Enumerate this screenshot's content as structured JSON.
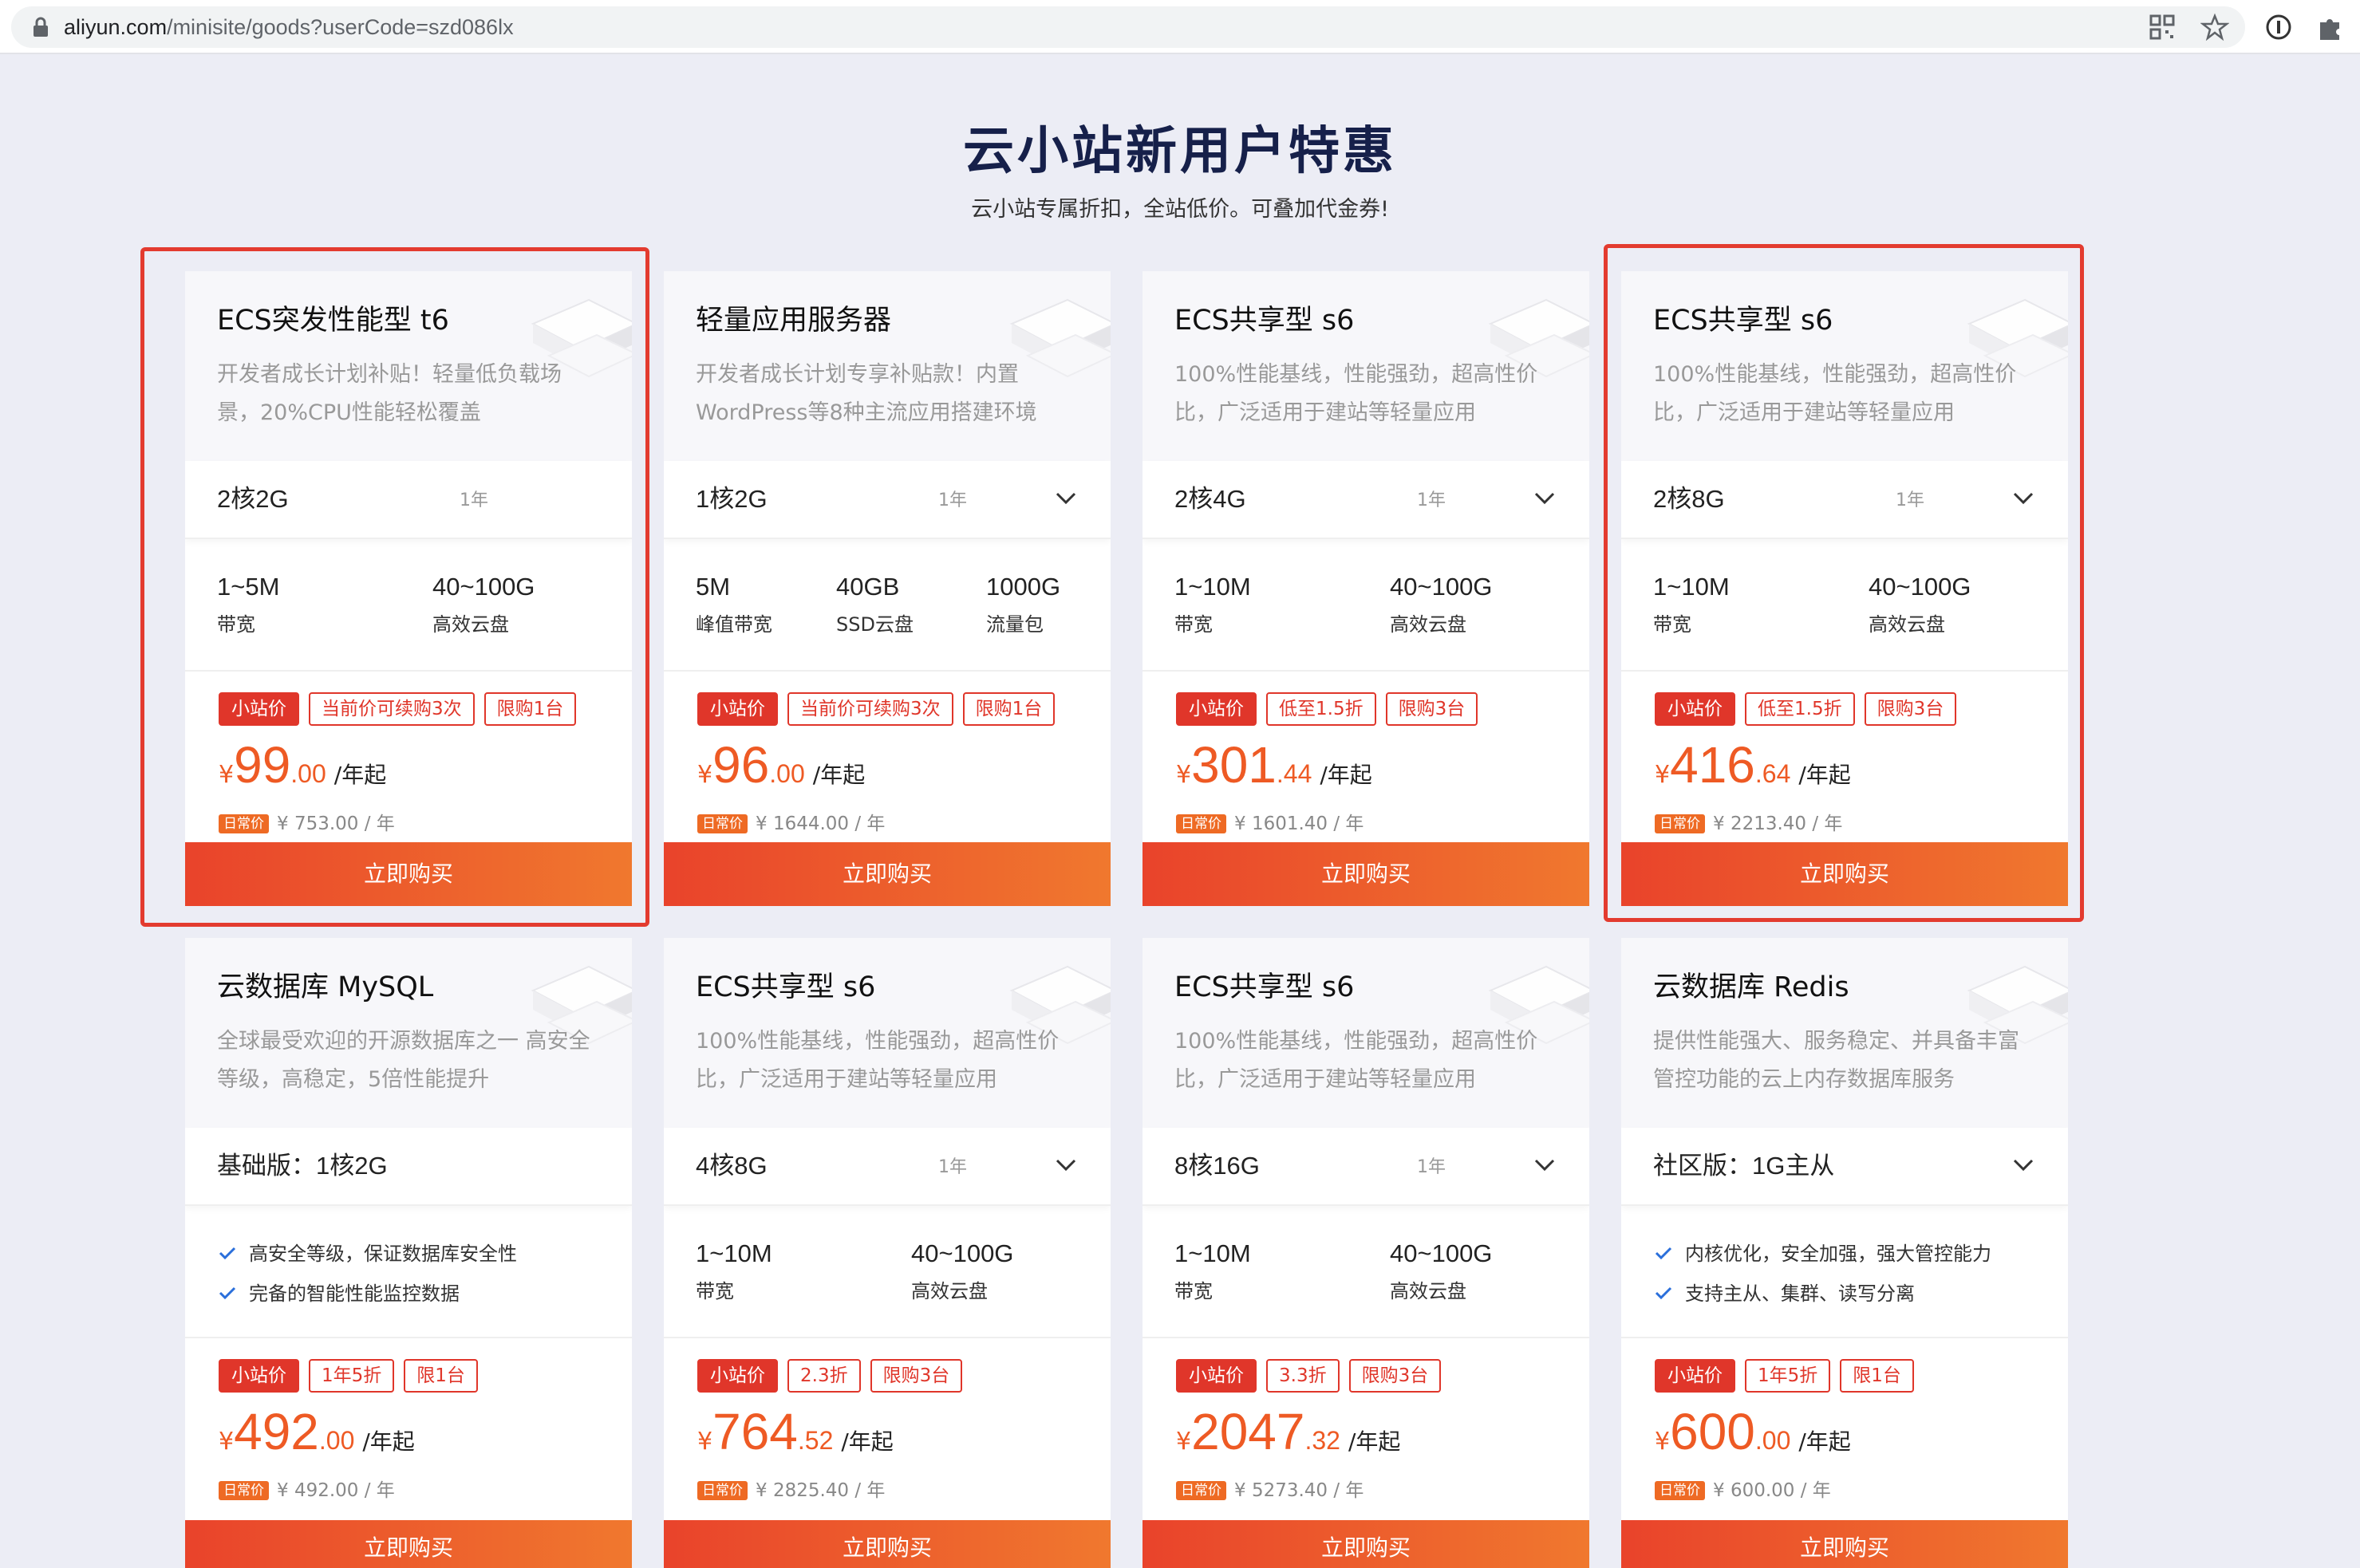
{
  "browser": {
    "url_host": "aliyun.com",
    "url_path": "/minisite/goods?userCode=szd086lx"
  },
  "header": {
    "title": "云小站新用户特惠",
    "subtitle": "云小站专属折扣，全站低价。可叠加代金券!"
  },
  "cards": [
    {
      "title": "ECS突发性能型 t6",
      "desc": "开发者成长计划补贴！轻量低负载场景，20%CPU性能轻松覆盖",
      "spec": "2核2G",
      "term": "1年",
      "specs": [
        {
          "v": "1~5M",
          "l": "带宽"
        },
        {
          "v": "40~100G",
          "l": "高效云盘"
        }
      ],
      "tags": [
        "小站价",
        "当前价可续购3次",
        "限购1台"
      ],
      "price_yen": "¥",
      "price_int": "99",
      "price_dec": ".00",
      "price_unit": "/年起",
      "orig_badge": "日常价",
      "orig": "¥ 753.00 / 年",
      "buy": "立即购买"
    },
    {
      "title": "轻量应用服务器",
      "desc": "开发者成长计划专享补贴款！内置WordPress等8种主流应用搭建环境",
      "spec": "1核2G",
      "term": "1年",
      "specs": [
        {
          "v": "5M",
          "l": "峰值带宽"
        },
        {
          "v": "40GB",
          "l": "SSD云盘"
        },
        {
          "v": "1000G",
          "l": "流量包"
        }
      ],
      "tags": [
        "小站价",
        "当前价可续购3次",
        "限购1台"
      ],
      "price_yen": "¥",
      "price_int": "96",
      "price_dec": ".00",
      "price_unit": "/年起",
      "orig_badge": "日常价",
      "orig": "¥ 1644.00 / 年",
      "buy": "立即购买"
    },
    {
      "title": "ECS共享型 s6",
      "desc": "100%性能基线，性能强劲，超高性价比，广泛适用于建站等轻量应用",
      "spec": "2核4G",
      "term": "1年",
      "specs": [
        {
          "v": "1~10M",
          "l": "带宽"
        },
        {
          "v": "40~100G",
          "l": "高效云盘"
        }
      ],
      "tags": [
        "小站价",
        "低至1.5折",
        "限购3台"
      ],
      "price_yen": "¥",
      "price_int": "301",
      "price_dec": ".44",
      "price_unit": "/年起",
      "orig_badge": "日常价",
      "orig": "¥ 1601.40 / 年",
      "buy": "立即购买"
    },
    {
      "title": "ECS共享型 s6",
      "desc": "100%性能基线，性能强劲，超高性价比，广泛适用于建站等轻量应用",
      "spec": "2核8G",
      "term": "1年",
      "specs": [
        {
          "v": "1~10M",
          "l": "带宽"
        },
        {
          "v": "40~100G",
          "l": "高效云盘"
        }
      ],
      "tags": [
        "小站价",
        "低至1.5折",
        "限购3台"
      ],
      "price_yen": "¥",
      "price_int": "416",
      "price_dec": ".64",
      "price_unit": "/年起",
      "orig_badge": "日常价",
      "orig": "¥ 2213.40 / 年",
      "buy": "立即购买"
    },
    {
      "title": "云数据库 MySQL",
      "desc": "全球最受欢迎的开源数据库之一 高安全等级，高稳定，5倍性能提升",
      "spec": "基础版：1核2G",
      "features": [
        "高安全等级，保证数据库安全性",
        "完备的智能性能监控数据"
      ],
      "tags": [
        "小站价",
        "1年5折",
        "限1台"
      ],
      "price_yen": "¥",
      "price_int": "492",
      "price_dec": ".00",
      "price_unit": "/年起",
      "orig_badge": "日常价",
      "orig": "¥ 492.00 / 年",
      "buy": "立即购买"
    },
    {
      "title": "ECS共享型 s6",
      "desc": "100%性能基线，性能强劲，超高性价比，广泛适用于建站等轻量应用",
      "spec": "4核8G",
      "term": "1年",
      "specs": [
        {
          "v": "1~10M",
          "l": "带宽"
        },
        {
          "v": "40~100G",
          "l": "高效云盘"
        }
      ],
      "tags": [
        "小站价",
        "2.3折",
        "限购3台"
      ],
      "price_yen": "¥",
      "price_int": "764",
      "price_dec": ".52",
      "price_unit": "/年起",
      "orig_badge": "日常价",
      "orig": "¥ 2825.40 / 年",
      "buy": "立即购买"
    },
    {
      "title": "ECS共享型 s6",
      "desc": "100%性能基线，性能强劲，超高性价比，广泛适用于建站等轻量应用",
      "spec": "8核16G",
      "term": "1年",
      "specs": [
        {
          "v": "1~10M",
          "l": "带宽"
        },
        {
          "v": "40~100G",
          "l": "高效云盘"
        }
      ],
      "tags": [
        "小站价",
        "3.3折",
        "限购3台"
      ],
      "price_yen": "¥",
      "price_int": "2047",
      "price_dec": ".32",
      "price_unit": "/年起",
      "orig_badge": "日常价",
      "orig": "¥ 5273.40 / 年",
      "buy": "立即购买"
    },
    {
      "title": "云数据库 Redis",
      "desc": "提供性能强大、服务稳定、并具备丰富管控功能的云上内存数据库服务",
      "spec": "社区版：1G主从",
      "features": [
        "内核优化，安全加强，强大管控能力",
        "支持主从、集群、读写分离"
      ],
      "tags": [
        "小站价",
        "1年5折",
        "限1台"
      ],
      "price_yen": "¥",
      "price_int": "600",
      "price_dec": ".00",
      "price_unit": "/年起",
      "orig_badge": "日常价",
      "orig": "¥ 600.00 / 年",
      "buy": "立即购买"
    }
  ],
  "colors": {
    "accent": "#ee5a24",
    "tag_red": "#e0362a",
    "highlight": "#e33b2f"
  }
}
